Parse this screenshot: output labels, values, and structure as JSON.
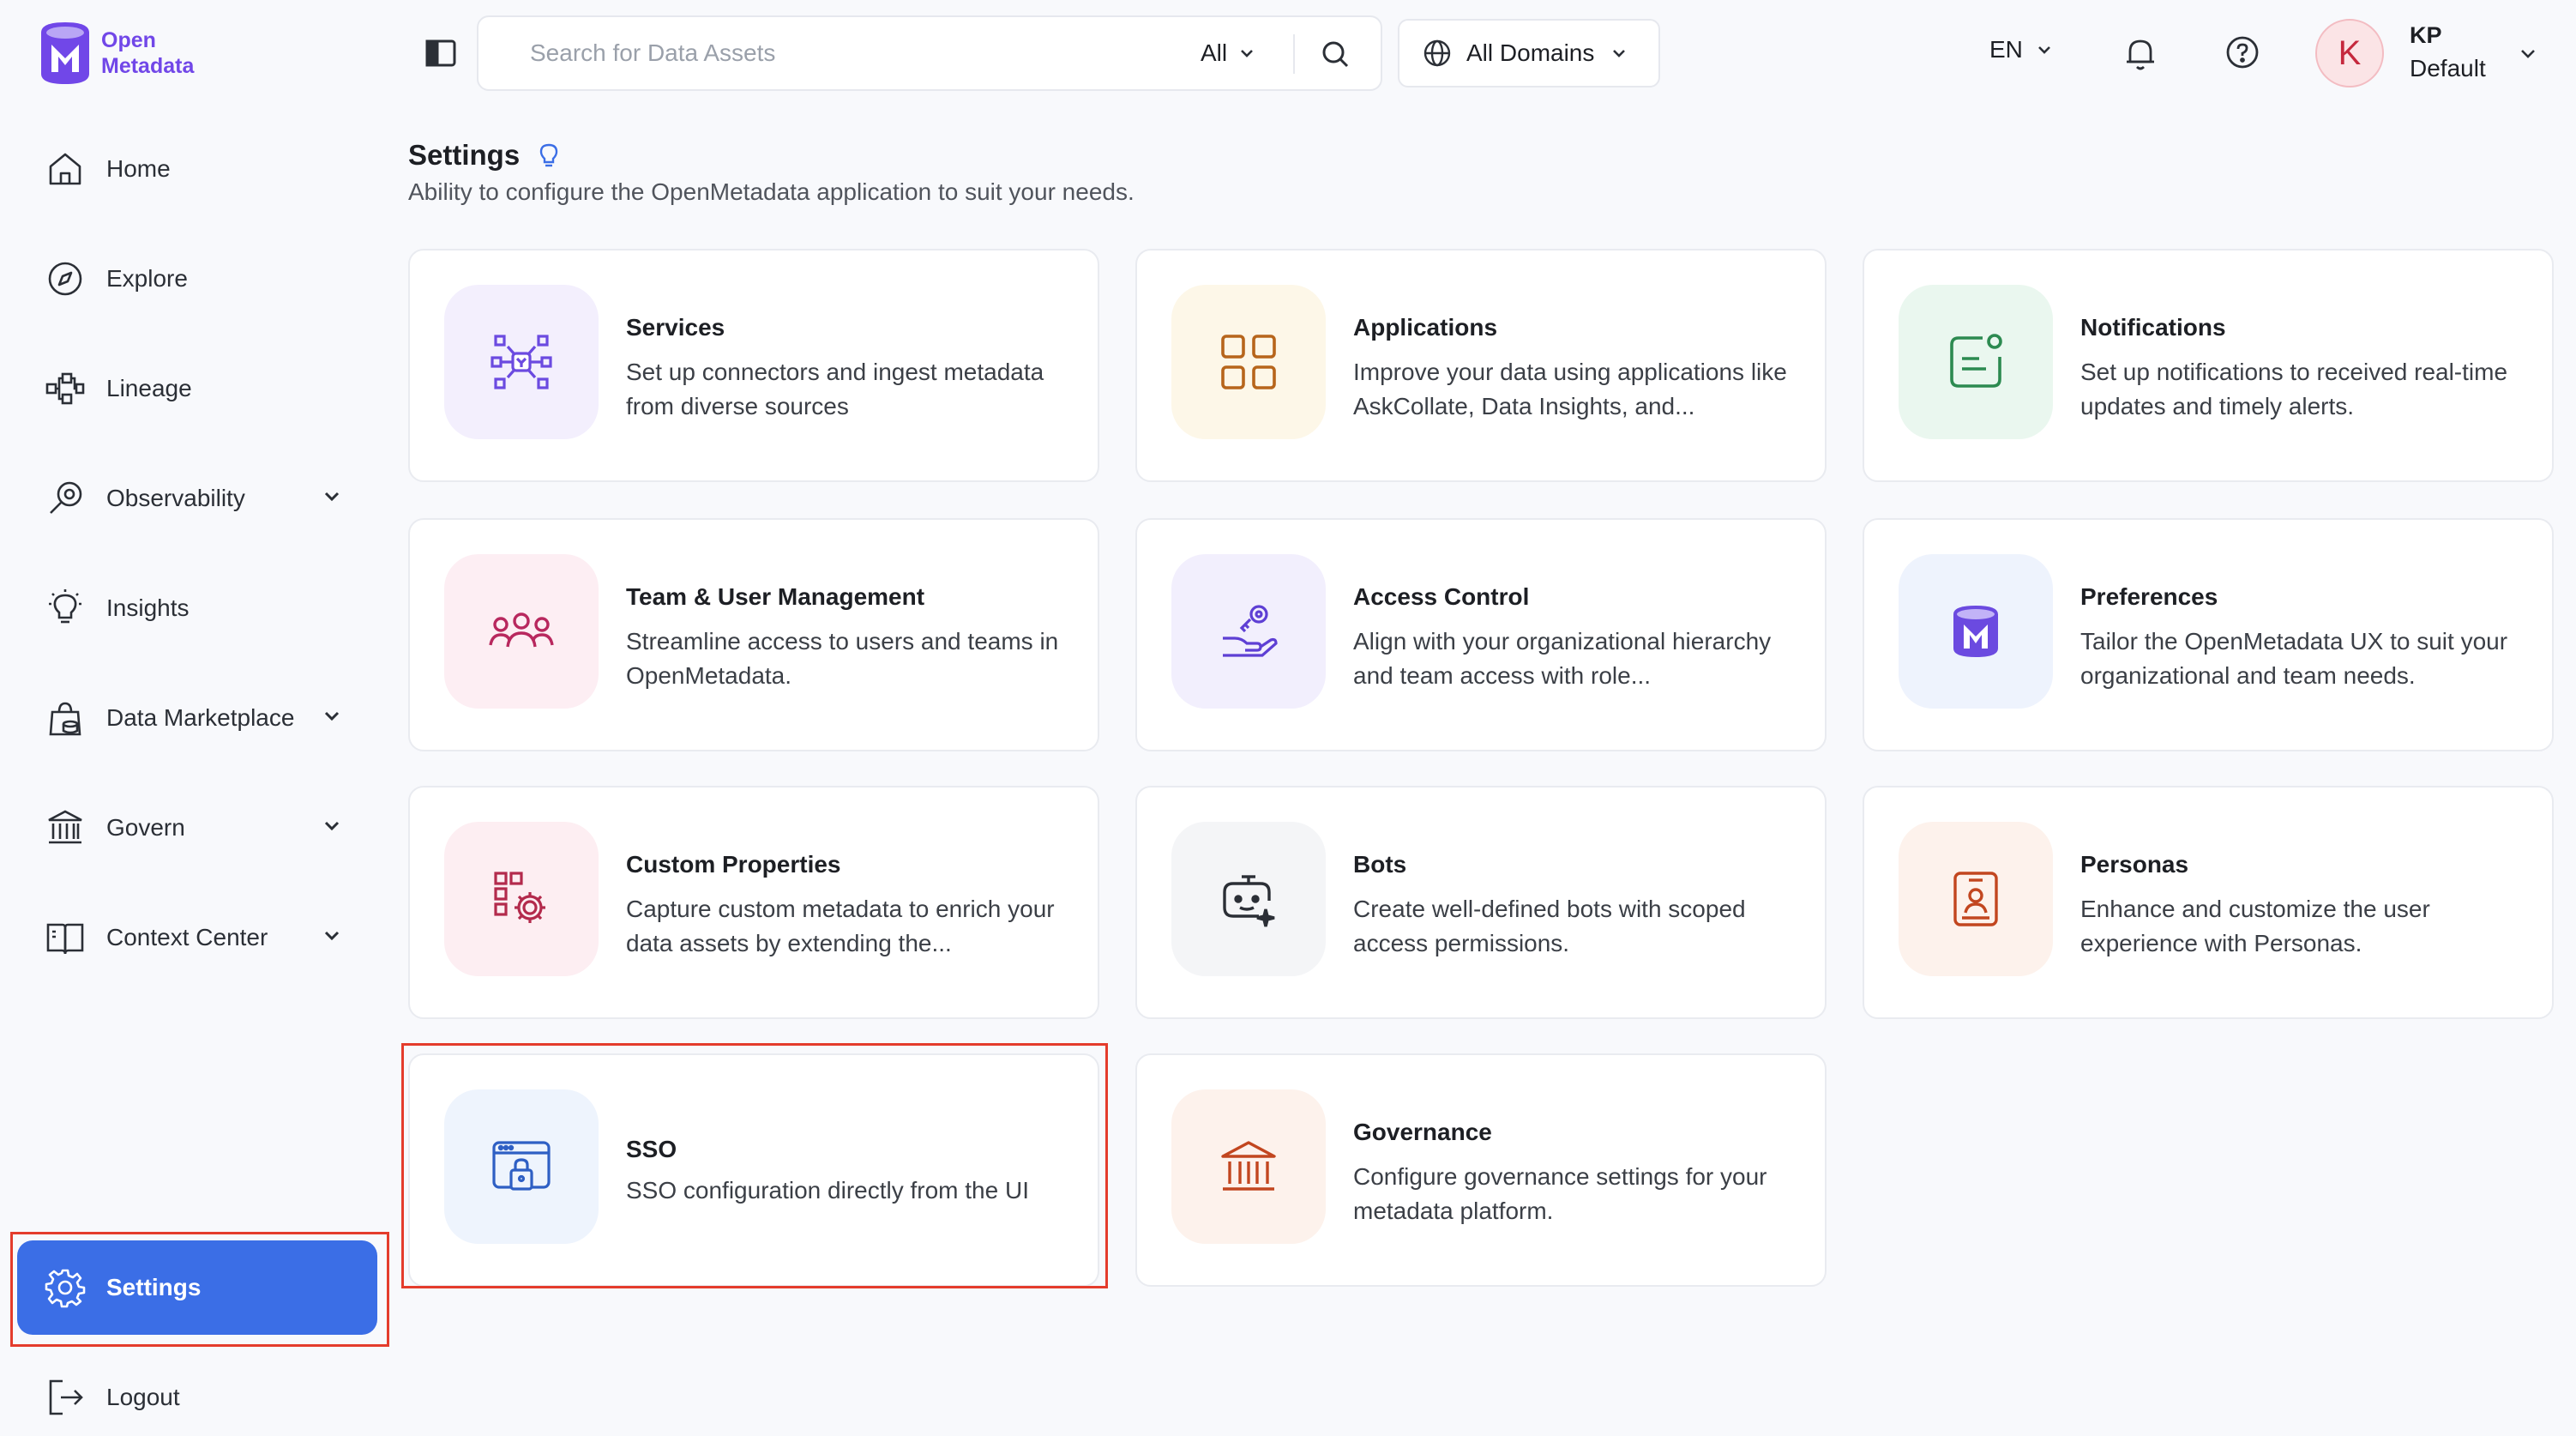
{
  "brand": {
    "line1": "Open",
    "line2": "Metadata",
    "color": "#7147e8"
  },
  "sidebar": {
    "items": [
      {
        "label": "Home",
        "icon": "home-icon"
      },
      {
        "label": "Explore",
        "icon": "compass-icon"
      },
      {
        "label": "Lineage",
        "icon": "lineage-icon"
      },
      {
        "label": "Observability",
        "icon": "observability-icon",
        "expandable": true
      },
      {
        "label": "Insights",
        "icon": "lightbulb-icon"
      },
      {
        "label": "Data Marketplace",
        "icon": "marketplace-icon",
        "expandable": true
      },
      {
        "label": "Govern",
        "icon": "govern-icon",
        "expandable": true
      },
      {
        "label": "Context Center",
        "icon": "book-icon",
        "expandable": true
      }
    ],
    "settings_label": "Settings",
    "logout_label": "Logout",
    "active_color": "#3b6ee6"
  },
  "topbar": {
    "search_placeholder": "Search for Data Assets",
    "search_filter": "All",
    "domains_label": "All Domains",
    "language": "EN",
    "user_initial": "K",
    "user_name": "KP",
    "user_role": "Default"
  },
  "page": {
    "title": "Settings",
    "subtitle": "Ability to configure the OpenMetadata application to suit your needs."
  },
  "cards": [
    {
      "title": "Services",
      "desc": "Set up connectors and ingest metadata from diverse sources",
      "icon": "services-icon",
      "bg": "#f3effd",
      "color": "#6b4ae0"
    },
    {
      "title": "Applications",
      "desc": "Improve your data using applications like AskCollate, Data Insights, and...",
      "icon": "applications-icon",
      "bg": "#fdf7e8",
      "color": "#b7651b"
    },
    {
      "title": "Notifications",
      "desc": "Set up notifications to received real-time updates and timely alerts.",
      "icon": "notifications-icon",
      "bg": "#eaf7ef",
      "color": "#2c8a50"
    },
    {
      "title": "Team & User Management",
      "desc": "Streamline access to users and teams in OpenMetadata.",
      "icon": "team-icon",
      "bg": "#fdeef3",
      "color": "#b8285e"
    },
    {
      "title": "Access Control",
      "desc": "Align with your organizational hierarchy and team access with role...",
      "icon": "access-control-icon",
      "bg": "#f2effd",
      "color": "#5e3fd4"
    },
    {
      "title": "Preferences",
      "desc": "Tailor the OpenMetadata UX to suit your organizational and team needs.",
      "icon": "preferences-icon",
      "bg": "#eef3fd",
      "color": "#6b4ae0"
    },
    {
      "title": "Custom Properties",
      "desc": "Capture custom metadata to enrich your data assets by extending the...",
      "icon": "custom-properties-icon",
      "bg": "#fdeef2",
      "color": "#b32a4c"
    },
    {
      "title": "Bots",
      "desc": "Create well-defined bots with scoped access permissions.",
      "icon": "bot-icon",
      "bg": "#f4f5f7",
      "color": "#2b2f36"
    },
    {
      "title": "Personas",
      "desc": "Enhance and customize the user experience with Personas.",
      "icon": "personas-icon",
      "bg": "#fdf2ec",
      "color": "#c2461f"
    },
    {
      "title": "SSO",
      "desc": "SSO configuration directly from the UI",
      "icon": "sso-icon",
      "bg": "#eef4fd",
      "color": "#2e5fc4"
    },
    {
      "title": "Governance",
      "desc": "Configure governance settings for your metadata platform.",
      "icon": "governance-icon",
      "bg": "#fdf2ec",
      "color": "#c2461f"
    }
  ],
  "highlight_color": "#e43c2c"
}
